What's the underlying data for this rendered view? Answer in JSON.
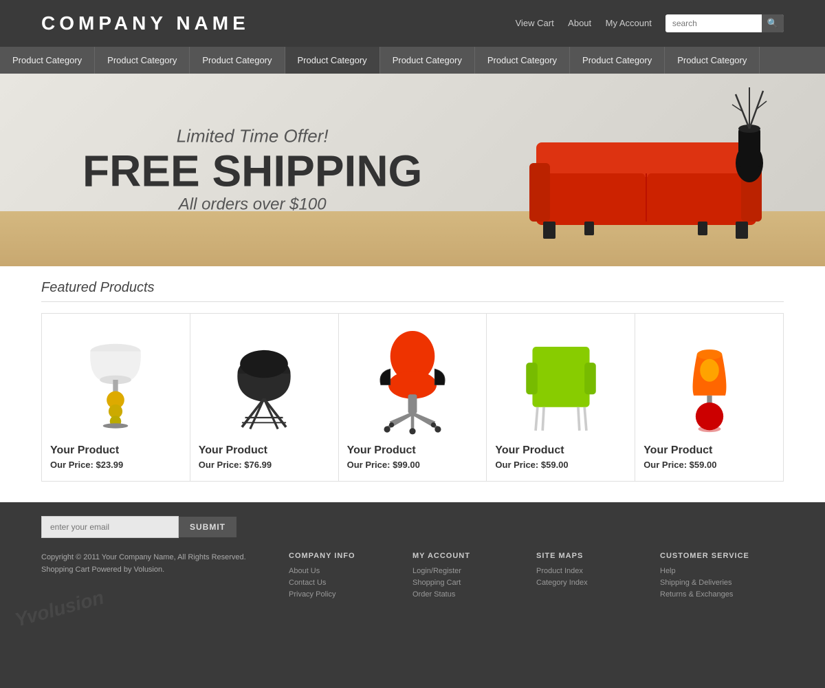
{
  "header": {
    "company_name": "COMPANY NAME",
    "nav_links": [
      "View Cart",
      "About",
      "My Account"
    ],
    "search_placeholder": "search"
  },
  "nav": {
    "items": [
      "Product Category",
      "Product Category",
      "Product Category",
      "Product Category",
      "Product Category",
      "Product Category",
      "Product Category",
      "Product Category"
    ]
  },
  "banner": {
    "line1": "Limited Time Offer!",
    "line2": "FREE SHIPPING",
    "line3": "All orders over $100"
  },
  "featured": {
    "title": "Featured Products",
    "products": [
      {
        "name": "Your Product",
        "price_label": "Our Price:",
        "price": "$23.99"
      },
      {
        "name": "Your Product",
        "price_label": "Our Price:",
        "price": "$76.99"
      },
      {
        "name": "Your Product",
        "price_label": "Our Price:",
        "price": "$99.00"
      },
      {
        "name": "Your Product",
        "price_label": "Our Price:",
        "price": "$59.00"
      },
      {
        "name": "Your Product",
        "price_label": "Our Price:",
        "price": "$59.00"
      }
    ]
  },
  "footer": {
    "email_placeholder": "enter your email",
    "submit_label": "SUBMIT",
    "copyright": "Copyright © 2011 Your Company Name, All Rights Reserved.",
    "powered_by": "Shopping Cart Powered by Volusion.",
    "company_info": {
      "heading": "COMPANY INFO",
      "links": [
        "About Us",
        "Contact Us",
        "Privacy Policy"
      ]
    },
    "my_account": {
      "heading": "MY ACCOUNT",
      "links": [
        "Login/Register",
        "Shopping Cart",
        "Order Status"
      ]
    },
    "site_maps": {
      "heading": "SITE MAPS",
      "links": [
        "Product Index",
        "Category Index"
      ]
    },
    "customer_service": {
      "heading": "CUSTOMER SERVICE",
      "links": [
        "Help",
        "Shipping & Deliveries",
        "Returns & Exchanges"
      ]
    },
    "volusion_text": "Yvolusion"
  }
}
